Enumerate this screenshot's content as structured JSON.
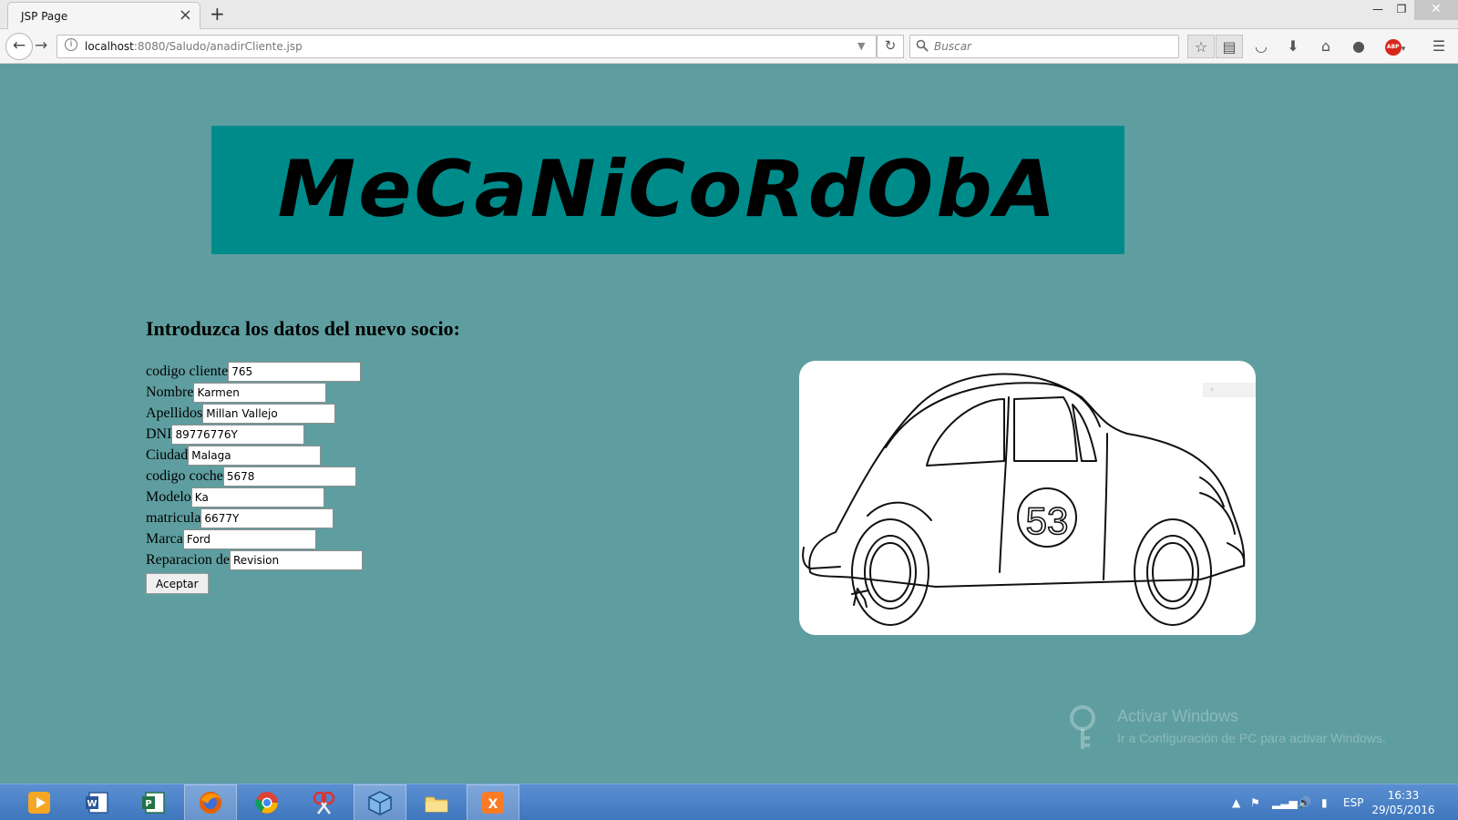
{
  "browser": {
    "tab_title": "JSP Page",
    "url_host": "localhost",
    "url_rest": ":8080/Saludo/anadirCliente.jsp",
    "search_placeholder": "Buscar",
    "abp_label": "ABP"
  },
  "page": {
    "banner_title": "MeCaNiCoRdObA",
    "heading": "Introduzca los datos del nuevo socio:",
    "fields": [
      {
        "label": "codigo cliente",
        "value": "765"
      },
      {
        "label": "Nombre",
        "value": "Karmen"
      },
      {
        "label": "Apellidos",
        "value": "Millan Vallejo"
      },
      {
        "label": "DNI",
        "value": "89776776Y"
      },
      {
        "label": "Ciudad",
        "value": "Malaga"
      },
      {
        "label": "codigo coche",
        "value": "5678"
      },
      {
        "label": "Modelo",
        "value": "Ka"
      },
      {
        "label": "matricula",
        "value": "6677Y"
      },
      {
        "label": "Marca",
        "value": "Ford"
      },
      {
        "label": "Reparacion de",
        "value": "Revision"
      }
    ],
    "submit_label": "Aceptar",
    "car_number": "53"
  },
  "watermark": {
    "title": "Activar Windows",
    "subtitle": "Ir a Configuración de PC para activar Windows."
  },
  "taskbar": {
    "apps": [
      "media-player",
      "word",
      "project",
      "firefox",
      "chrome",
      "snipping-tool",
      "virtualbox",
      "file-explorer",
      "xampp"
    ],
    "active_app": "firefox",
    "language": "ESP",
    "time": "16:33",
    "date": "29/05/2016"
  },
  "colors": {
    "page_background": "#5f9ea0",
    "banner_background": "#008b8b",
    "taskbar": "#4a82c8"
  }
}
